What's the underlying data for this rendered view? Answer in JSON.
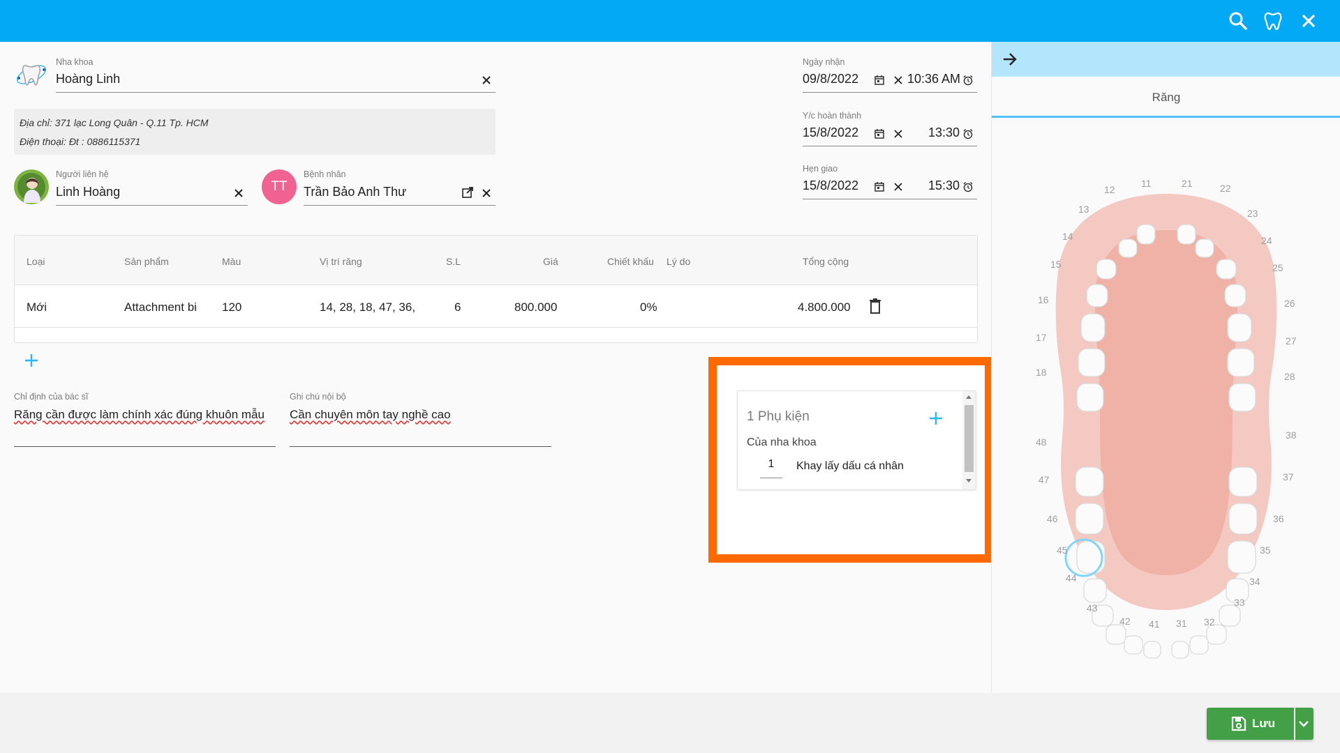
{
  "top_bar": {
    "icons": [
      "search-icon",
      "tooth-icon",
      "close-icon"
    ]
  },
  "clinic": {
    "label": "Nha khoa",
    "value": "Hoàng Linh"
  },
  "address": {
    "line1": "Địa chỉ: 371 lạc Long Quân - Q.11 Tp. HCM",
    "line2": "Điện thoại: Đt : 0886115371"
  },
  "contact": {
    "label": "Người liên hệ",
    "value": "Linh Hoàng"
  },
  "patient": {
    "label": "Bệnh nhân",
    "value": "Trần Bảo Anh Thư",
    "initials": "TT"
  },
  "dates": {
    "received": {
      "label": "Ngày nhận",
      "date": "09/8/2022",
      "time": "10:36 AM"
    },
    "complete": {
      "label": "Y/c hoàn thành",
      "date": "15/8/2022",
      "time": "13:30"
    },
    "delivery": {
      "label": "Hẹn giao",
      "date": "15/8/2022",
      "time": "15:30"
    }
  },
  "table": {
    "headers": [
      "Loại",
      "Sản phẩm",
      "Màu",
      "Vị trí răng",
      "S.L",
      "Giá",
      "Chiết khấu",
      "Lý do",
      "Tổng cộng"
    ],
    "rows": [
      {
        "type": "Mới",
        "product": "Attachment bi",
        "color": "120",
        "teeth": "14, 28, 18, 47, 36,",
        "qty": "6",
        "price": "800.000",
        "discount": "0%",
        "reason": "",
        "total": "4.800.000"
      }
    ]
  },
  "notes": {
    "doctor": {
      "label": "Chỉ định của bác sĩ",
      "value": "Răng cần được làm chính xác đúng khuôn mẫu"
    },
    "internal": {
      "label": "Ghi chú nội bộ",
      "value": "Cần chuyên môn tay nghề cao"
    }
  },
  "accessories": {
    "title": "1 Phụ kiện",
    "group": "Của nha khoa",
    "items": [
      {
        "qty": "1",
        "name": "Khay lấy dấu cá nhân"
      }
    ]
  },
  "right_panel": {
    "tab": "Răng",
    "selected_tooth": "46",
    "teeth_upper": [
      "11",
      "12",
      "13",
      "14",
      "15",
      "16",
      "17",
      "18",
      "21",
      "22",
      "23",
      "24",
      "25",
      "26",
      "27",
      "28"
    ],
    "teeth_lower": [
      "31",
      "32",
      "33",
      "34",
      "35",
      "36",
      "37",
      "38",
      "41",
      "42",
      "43",
      "44",
      "45",
      "46",
      "47",
      "48"
    ]
  },
  "footer": {
    "save_label": "Lưu"
  },
  "colors": {
    "topbar": "#03a9f4",
    "panel_header": "#b3e5fc",
    "highlight": "#ff6a00",
    "save": "#43a047",
    "accent": "#29b6f6",
    "avatar_tt": "#f06292"
  }
}
